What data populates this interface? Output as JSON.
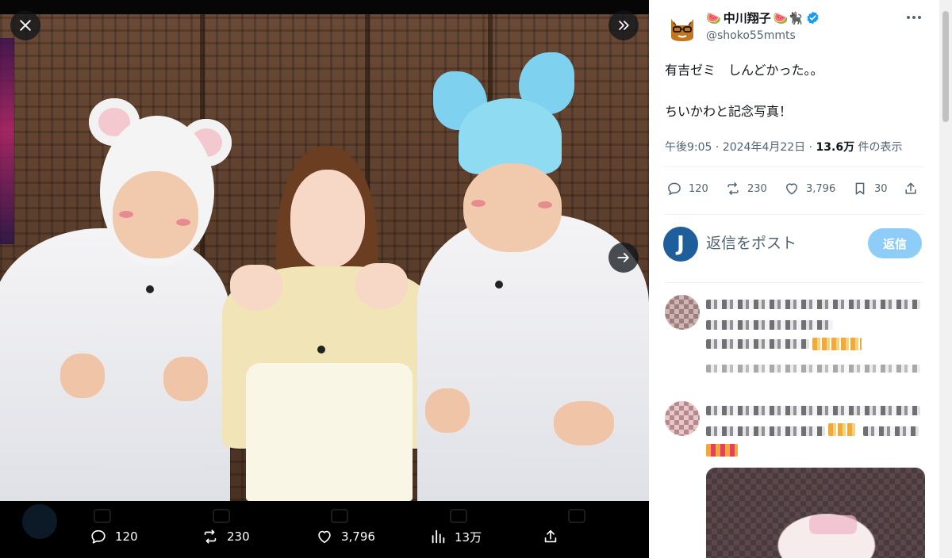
{
  "viewer": {
    "close_label": "close",
    "collapse_label": "collapse",
    "next_label": "next",
    "actions": {
      "reply_count": "120",
      "retweet_count": "230",
      "like_count": "3,796",
      "views_count": "13万"
    }
  },
  "tweet": {
    "author": {
      "display_name": "中川翔子",
      "emoji_left": "🍉",
      "emoji_right": "🍉🐈‍⬛",
      "handle": "@shoko55mmts",
      "verified": true
    },
    "text_lines": [
      "有吉ゼミ　しんどかった。。",
      "ちいかわと記念写真！"
    ],
    "meta": {
      "time": "午後9:05",
      "sep1": "·",
      "date": "2024年4月22日",
      "sep2": "·",
      "views_value": "13.6万",
      "views_suffix": "件の表示"
    },
    "stats": {
      "replies": "120",
      "retweets": "230",
      "likes": "3,796",
      "bookmarks": "30"
    },
    "reply_box": {
      "avatar_letter": "J",
      "placeholder": "返信をポスト",
      "button_label": "返信"
    }
  },
  "colors": {
    "accent": "#1d9bf0",
    "reply_button": "#8ecdf8",
    "verified": "#1d9bf0",
    "text_primary": "#0f1419",
    "text_secondary": "#536471"
  }
}
